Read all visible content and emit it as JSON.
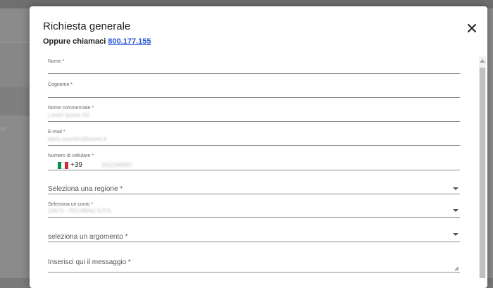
{
  "background": {
    "partial_text": "nt"
  },
  "dialog": {
    "title": "Richiesta generale",
    "subtitle_prefix": "Oppure chiamaci",
    "phone_link": "800.177.155",
    "close_icon": "close-icon"
  },
  "form": {
    "nome": {
      "label": "Nome *",
      "value": ""
    },
    "cognome": {
      "label": "Cognome *",
      "value": ""
    },
    "nome_commerciale": {
      "label": "Nome commerciale *",
      "value": "Lorem Ipsum Srl"
    },
    "email": {
      "label": "E-mail *",
      "value": "dario.zucchini@lorem.it"
    },
    "cellulare": {
      "label": "Numero di cellulare *",
      "country_code": "+39",
      "country_flag": "italy-flag-icon",
      "value": "3311349567"
    },
    "regione": {
      "label": "Seleziona una regione *"
    },
    "conto": {
      "label": "Seleziona un conto *",
      "value": "15673 - TECHBAU S.P.A."
    },
    "argomento": {
      "label": "seleziona un argomento *"
    },
    "messaggio": {
      "label": "Inserisci qui il messaggio *"
    }
  },
  "colors": {
    "link": "#2a57d6",
    "flag_green": "#009246",
    "flag_white": "#ffffff",
    "flag_red": "#ce2b37"
  }
}
